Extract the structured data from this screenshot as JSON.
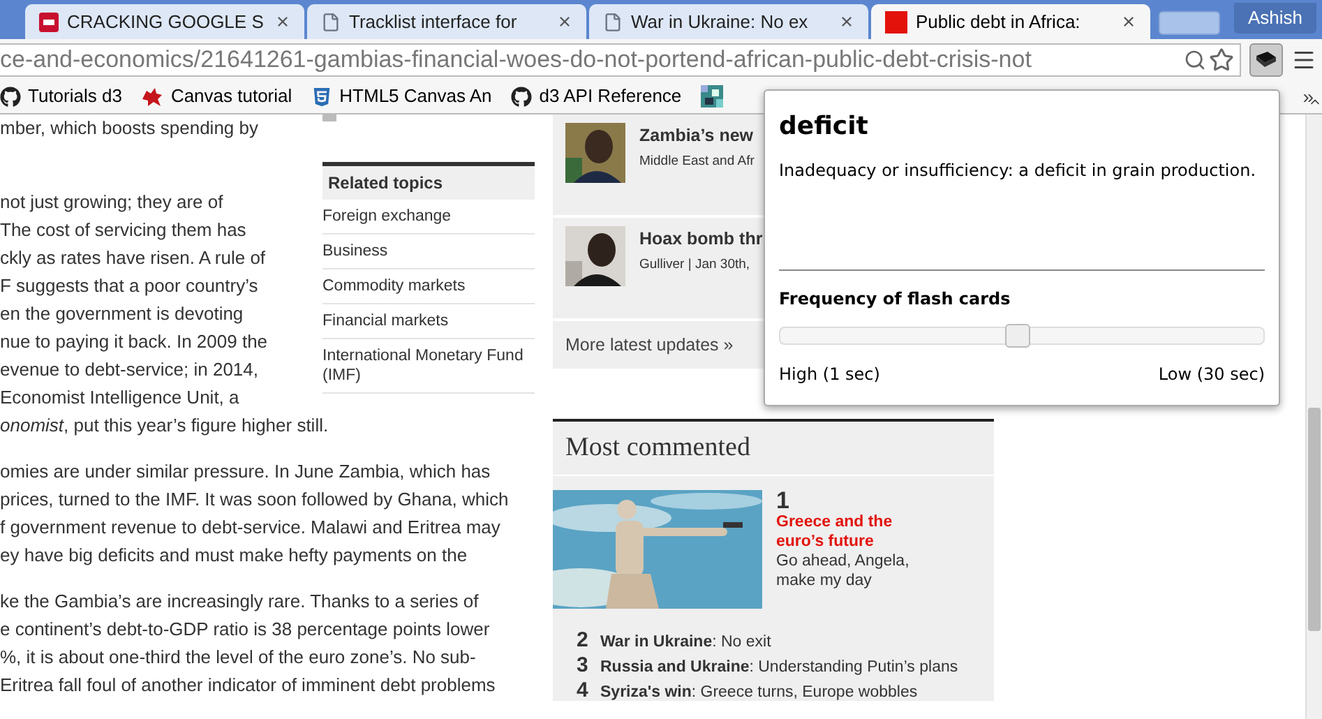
{
  "tabs": [
    {
      "title": "CRACKING GOOGLE S",
      "kind": "sd",
      "selected": false
    },
    {
      "title": "Tracklist interface for",
      "kind": "page",
      "selected": false
    },
    {
      "title": "War in Ukraine: No ex",
      "kind": "page",
      "selected": false
    },
    {
      "title": "Public debt in Africa:",
      "kind": "red",
      "selected": true
    }
  ],
  "user": "Ashish",
  "address": {
    "url": "ce-and-economics/21641261-gambias-financial-woes-do-not-portend-african-public-debt-crisis-not"
  },
  "bookmarks": [
    {
      "label": "Tutorials d3",
      "kind": "github"
    },
    {
      "label": "Canvas tutorial",
      "kind": "dragon"
    },
    {
      "label": "HTML5 Canvas An",
      "kind": "html5"
    },
    {
      "label": "d3 API Reference",
      "kind": "github"
    },
    {
      "kind": "pixel"
    }
  ],
  "bookmarks_more": "»",
  "article": {
    "paragraphs": [
      {
        "lines": [
          "mber, which boosts spending by"
        ]
      },
      {
        "lines": [
          "not just growing; they are of",
          "The cost of servicing them has",
          "ckly as rates have risen. A rule of",
          "F suggests that a poor country’s",
          "en the government is devoting",
          "nue to paying it back. In 2009 the",
          "evenue to debt-service; in 2014,",
          "Economist Intelligence Unit, a",
          "*onomist*, put this year’s figure higher still."
        ]
      },
      {
        "lines": [
          "omies are under similar pressure. In June Zambia, which has",
          "prices, turned to the IMF. It was soon followed by Ghana, which",
          "f government revenue to debt-service. Malawi and Eritrea may",
          "ey have big deficits and must make hefty payments on the"
        ]
      },
      {
        "lines": [
          "ke the Gambia’s are increasingly rare. Thanks to a series of",
          "e continent’s debt-to-GDP ratio is 38 percentage points lower",
          "%, it is about one-third the level of the euro zone’s. No sub-",
          "Eritrea fall foul of another indicator of imminent debt problems"
        ]
      }
    ]
  },
  "related": {
    "title": "Related topics",
    "items": [
      "Foreign exchange",
      "Business",
      "Commodity markets",
      "Financial markets",
      "International Monetary Fund (IMF)"
    ]
  },
  "latest": {
    "items": [
      {
        "title": "Zambia’s new",
        "meta": "Middle East and Afr"
      },
      {
        "title": "Hoax bomb thr",
        "meta": "Gulliver | Jan 30th,"
      }
    ],
    "more": "More latest updates »"
  },
  "most_commented": {
    "title": "Most commented",
    "top": {
      "rank": "1",
      "title": "Greece and the euro’s future",
      "subtitle": "Go ahead, Angela, make my day"
    },
    "items": [
      {
        "rank": "2",
        "text": "**War in Ukraine**: No exit"
      },
      {
        "rank": "3",
        "text": "**Russia and Ukraine**: Understanding Putin’s plans"
      },
      {
        "rank": "4",
        "text": "**Syriza's win**: Greece turns, Europe wobbles"
      }
    ]
  },
  "popup": {
    "word": "deficit",
    "definition": "Inadequacy or insufficiency: a deficit in grain production.",
    "setting": "Frequency of flash cards",
    "slider": {
      "level": 0.49
    },
    "min_label": "High (1 sec)",
    "max_label": "Low (30 sec)"
  }
}
